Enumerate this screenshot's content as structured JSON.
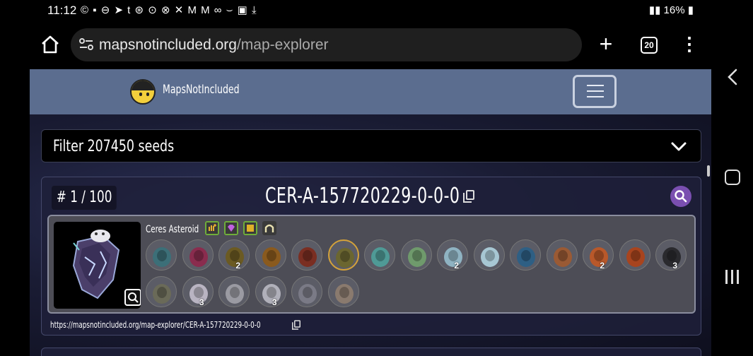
{
  "status_bar": {
    "time": "11:12",
    "notification_icons": "© ▪ ⊖ ➤ t ⊛ ⊙ ⊗ ✕ M M ∞ ⌣ ▣ ⤓",
    "battery": "16%"
  },
  "browser": {
    "url_domain": "mapsnotincluded.org",
    "url_path": "/map-explorer",
    "tab_count": "20"
  },
  "site": {
    "name": "MapsNotIncluded"
  },
  "filter": {
    "label": "Filter 207450 seeds"
  },
  "seed": {
    "rank": "# 1 / 100",
    "title": "CER-A-157720229-0-0-0",
    "asteroid_name": "Ceres Asteroid",
    "url": "https://mapsnotincluded.org/map-explorer/CER-A-157720229-0-0-0",
    "traits": [
      {
        "icon": "hand-plus-trait-icon",
        "color": "#6fae3a"
      },
      {
        "icon": "gem-trait-icon",
        "color": "#6fae3a"
      },
      {
        "icon": "ore-trait-icon",
        "color": "#6fae3a"
      },
      {
        "icon": "arch-trait-icon",
        "color": "#3a3a3a"
      }
    ],
    "geysers_row1": [
      {
        "icon": "hand-vent-teal-icon",
        "color": "#3c6f78",
        "count": ""
      },
      {
        "icon": "hand-vent-magenta-icon",
        "color": "#8a2c4e",
        "count": ""
      },
      {
        "icon": "hand-vent-olive-icon",
        "color": "#6b5a22",
        "count": "2"
      },
      {
        "icon": "hand-vent-amber-icon",
        "color": "#8a5a1e",
        "count": ""
      },
      {
        "icon": "hand-vent-rust-icon",
        "color": "#7a2e22",
        "count": ""
      },
      {
        "icon": "hand-vent-olive-selected-icon",
        "color": "#6b6630",
        "count": "",
        "selected": true
      },
      {
        "icon": "geyser-teal-icon",
        "color": "#4f9a96",
        "count": ""
      },
      {
        "icon": "geyser-green-icon",
        "color": "#6f9a6c",
        "count": ""
      },
      {
        "icon": "geyser-pale-icon",
        "color": "#8fb3c2",
        "count": "2"
      },
      {
        "icon": "geyser-ice-icon",
        "color": "#a7c7d3",
        "count": ""
      },
      {
        "icon": "geyser-blue-icon",
        "color": "#2e5f84",
        "count": ""
      },
      {
        "icon": "volcano-brown-icon",
        "color": "#9a5a34",
        "count": ""
      },
      {
        "icon": "volcano-orange-icon",
        "color": "#b8582a",
        "count": "2"
      },
      {
        "icon": "volcano-red-icon",
        "color": "#a8441e",
        "count": ""
      },
      {
        "icon": "volcano-black-icon",
        "color": "#2a2a2e",
        "count": "3"
      }
    ],
    "geysers_row2": [
      {
        "icon": "arch-building-icon",
        "color": "#6a6a58",
        "count": ""
      },
      {
        "icon": "capsule-machine-icon",
        "color": "#b9b4c2",
        "count": "3"
      },
      {
        "icon": "printer-machine-icon",
        "color": "#9a9aa2",
        "count": ""
      },
      {
        "icon": "lamp-machine-icon",
        "color": "#b0b0ba",
        "count": "3"
      },
      {
        "icon": "vault-machine-icon",
        "color": "#7a7a86",
        "count": ""
      },
      {
        "icon": "hourglass-machine-icon",
        "color": "#8a7a6e",
        "count": ""
      }
    ]
  }
}
